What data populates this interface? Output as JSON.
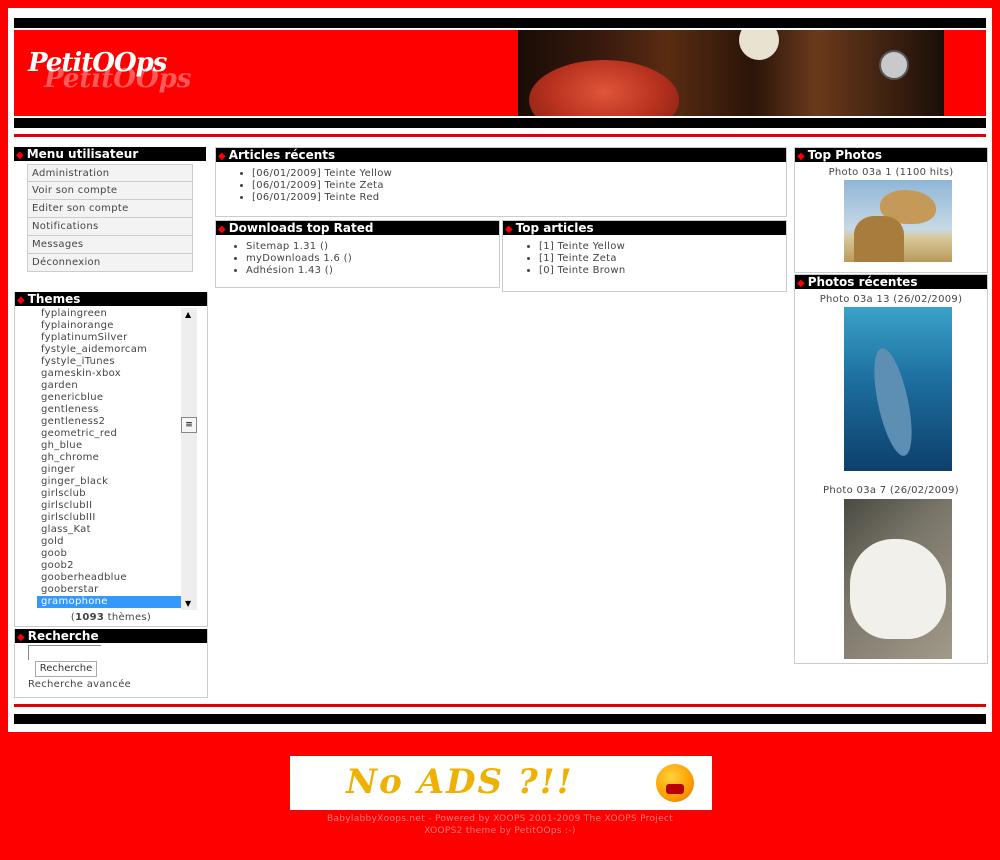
{
  "header": {
    "logo_text": "PetitOOps"
  },
  "menu_user": {
    "title": "Menu utilisateur",
    "items": [
      "Administration",
      "Voir son compte",
      "Editer son compte",
      "Notifications",
      "Messages",
      "Déconnexion"
    ]
  },
  "themes": {
    "title": "Themes",
    "items": [
      "fyplaingreen",
      "fyplainorange",
      "fyplatinumSilver",
      "fystyle_aidemorcam",
      "fystyle_iTunes",
      "gameskin-xbox",
      "garden",
      "genericblue",
      "gentleness",
      "gentleness2",
      "geometric_red",
      "gh_blue",
      "gh_chrome",
      "ginger",
      "ginger_black",
      "girlsclub",
      "girlsclubII",
      "girlsclubIII",
      "glass_Kat",
      "gold",
      "goob",
      "goob2",
      "gooberheadblue",
      "gooberstar",
      "gramophone"
    ],
    "selected": "gramophone",
    "count": "1093",
    "count_suffix": "thèmes"
  },
  "search": {
    "title": "Recherche",
    "button": "Recherche",
    "advanced": "Recherche avancée"
  },
  "articles_recents": {
    "title": "Articles récents",
    "items": [
      "[06/01/2009] Teinte Yellow",
      "[06/01/2009] Teinte Zeta",
      "[06/01/2009] Teinte Red"
    ]
  },
  "downloads": {
    "title": "Downloads top Rated",
    "items": [
      "Sitemap 1.31 ()",
      "myDownloads 1.6 ()",
      "Adhésion 1.43 ()"
    ]
  },
  "top_articles": {
    "title": "Top articles",
    "items": [
      "[1] Teinte Yellow",
      "[1] Teinte Zeta",
      "[0] Teinte Brown"
    ]
  },
  "top_photos": {
    "title": "Top Photos",
    "caption": "Photo 03a 1 (1100 hits)"
  },
  "photos_recentes": {
    "title": "Photos récentes",
    "caption1": "Photo 03a 13 (26/02/2009)",
    "caption2": "Photo 03a 7 (26/02/2009)"
  },
  "footer": {
    "ad_text": "No ADS ?!!",
    "line1": "BabylabbyXoops.net - Powered by XOOPS 2001-2009 The XOOPS Project",
    "line2": "XOOPS2 theme by PetitOOps :-)"
  },
  "colors": {
    "accent": "#ff0000",
    "bar": "#000000",
    "selected": "#3399ff"
  }
}
